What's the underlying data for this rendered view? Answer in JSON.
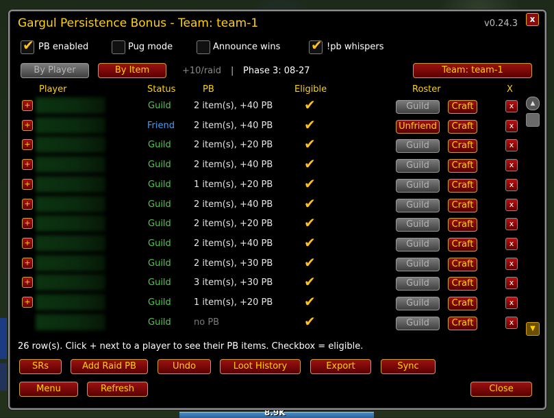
{
  "window": {
    "title": "Gargul Persistence Bonus - Team: team-1",
    "version": "v0.24.3",
    "close_glyph": "x"
  },
  "options": [
    {
      "label": "PB enabled",
      "checked": true
    },
    {
      "label": "Pug mode",
      "checked": false
    },
    {
      "label": "Announce wins",
      "checked": false
    },
    {
      "label": "!pb whispers",
      "checked": true
    }
  ],
  "toolbar": {
    "by_player": "By Player",
    "by_item": "By Item",
    "raid_bonus": "+10/raid",
    "separator": "|",
    "phase": "Phase 3: 08-27",
    "team_button": "Team: team-1"
  },
  "columns": {
    "player": "Player",
    "status": "Status",
    "pb": "PB",
    "eligible": "Eligible",
    "roster": "Roster",
    "x": "X"
  },
  "rows": [
    {
      "status": "Guild",
      "pb": "2 item(s), +40 PB",
      "roster_status": "Guild",
      "roster_role": "Craft",
      "has_plus": true
    },
    {
      "status": "Friend",
      "pb": "2 item(s), +40 PB",
      "roster_status": "Unfriend",
      "roster_role": "Craft",
      "has_plus": true
    },
    {
      "status": "Guild",
      "pb": "2 item(s), +20 PB",
      "roster_status": "Guild",
      "roster_role": "Craft",
      "has_plus": true
    },
    {
      "status": "Guild",
      "pb": "2 item(s), +40 PB",
      "roster_status": "Guild",
      "roster_role": "Craft",
      "has_plus": true
    },
    {
      "status": "Guild",
      "pb": "1 item(s), +20 PB",
      "roster_status": "Guild",
      "roster_role": "Craft",
      "has_plus": true
    },
    {
      "status": "Guild",
      "pb": "2 item(s), +40 PB",
      "roster_status": "Guild",
      "roster_role": "Craft",
      "has_plus": true
    },
    {
      "status": "Guild",
      "pb": "2 item(s), +20 PB",
      "roster_status": "Guild",
      "roster_role": "Craft",
      "has_plus": true
    },
    {
      "status": "Guild",
      "pb": "2 item(s), +40 PB",
      "roster_status": "Guild",
      "roster_role": "Craft",
      "has_plus": true
    },
    {
      "status": "Guild",
      "pb": "2 item(s), +30 PB",
      "roster_status": "Guild",
      "roster_role": "Craft",
      "has_plus": true
    },
    {
      "status": "Guild",
      "pb": "3 item(s), +30 PB",
      "roster_status": "Guild",
      "roster_role": "Craft",
      "has_plus": true
    },
    {
      "status": "Guild",
      "pb": "1 item(s), +20 PB",
      "roster_status": "Guild",
      "roster_role": "Craft",
      "has_plus": true
    },
    {
      "status": "Guild",
      "pb": "no PB",
      "roster_status": "Guild",
      "roster_role": "Craft",
      "has_plus": false
    }
  ],
  "row_glyphs": {
    "plus": "+",
    "remove": "x",
    "check": "✔"
  },
  "footer_note": "26 row(s). Click + next to a player to see their PB items. Checkbox = eligible.",
  "actions": {
    "srs": "SRs",
    "add_raid_pb": "Add Raid PB",
    "undo": "Undo",
    "loot_history": "Loot History",
    "export": "Export",
    "sync": "Sync",
    "menu": "Menu",
    "refresh": "Refresh",
    "close": "Close"
  },
  "background": {
    "bar_value": "8.9K"
  },
  "colors": {
    "title": "#ffd200",
    "status_guild": "#4fc84f",
    "status_friend": "#4c9cf0",
    "button_red": "#8a0b0b",
    "check_gold": "#ffc21a"
  }
}
